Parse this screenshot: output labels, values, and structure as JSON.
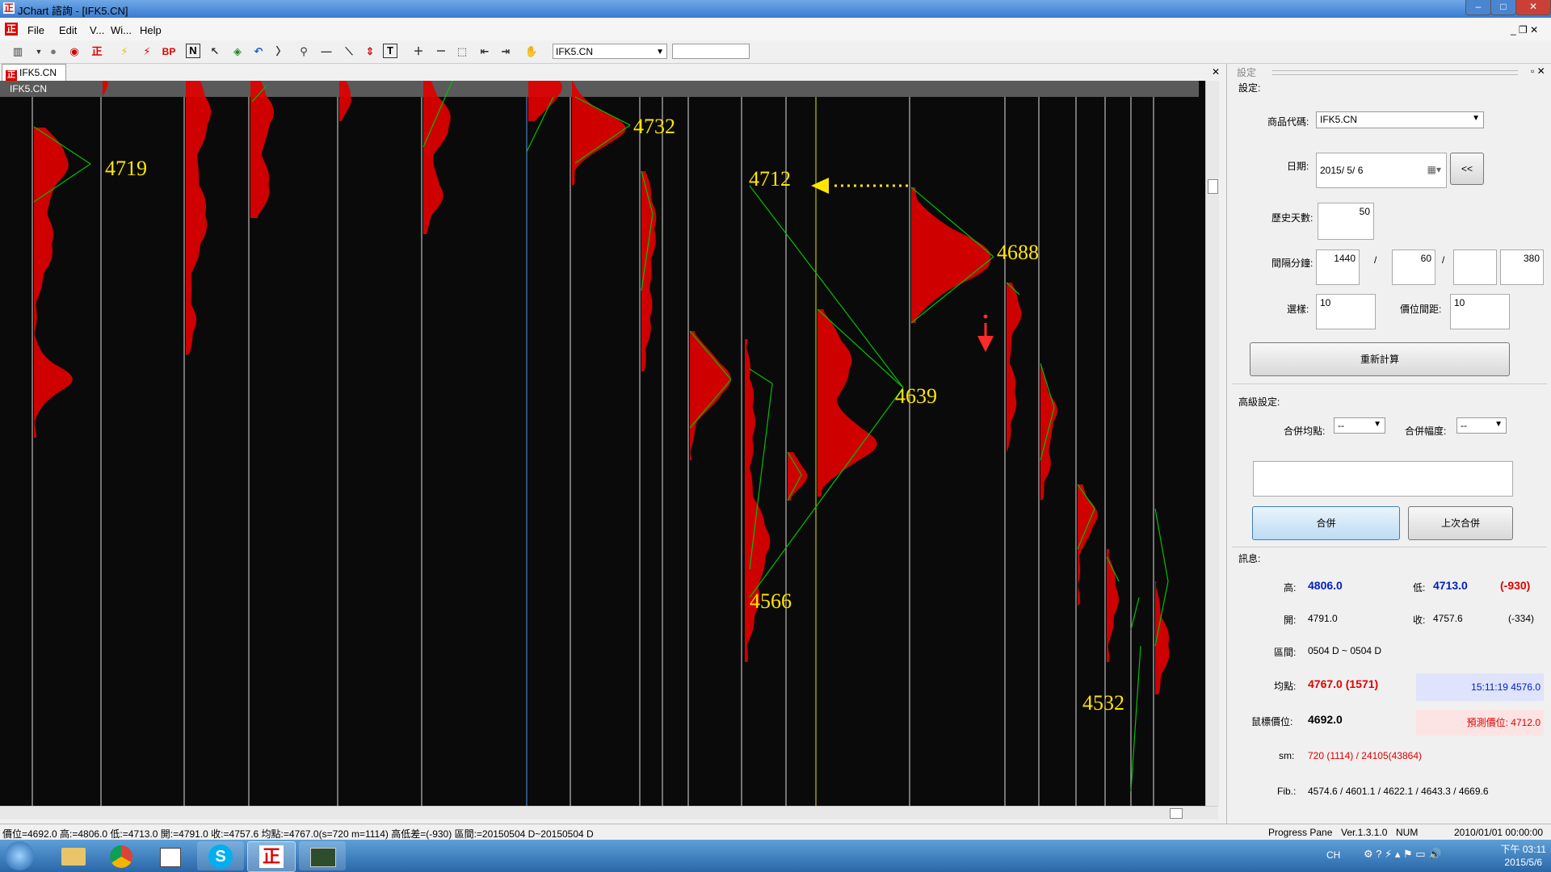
{
  "window": {
    "title": "JChart 諮詢 - [IFK5.CN]"
  },
  "menu": {
    "file": "File",
    "edit": "Edit",
    "view": "V...",
    "window": "Wi...",
    "help": "Help"
  },
  "toolbar": {
    "bp_label": "BP",
    "n_label": "N",
    "t_label": "T",
    "symbol": "IFK5.CN"
  },
  "chart_tab": {
    "label": "IFK5.CN"
  },
  "chart": {
    "header": "IFK5.CN",
    "labels": [
      "4719",
      "4732",
      "4712",
      "4688",
      "4639",
      "4566",
      "4532"
    ]
  },
  "panel": {
    "settings_title": "設定",
    "settings_section": "設定:",
    "symbol_label": "商品代碼:",
    "symbol_value": "IFK5.CN",
    "date_label": "日期:",
    "date_value": "2015/ 5/ 6",
    "back_button": "<<",
    "history_label": "歷史天數:",
    "history_value": "50",
    "interval_label": "間隔分鐘:",
    "interval_1": "1440",
    "interval_sep1": "/",
    "interval_2": "60",
    "interval_sep2": "/",
    "interval_3": "",
    "interval_4": "380",
    "select_label": "選樣:",
    "select_value": "10",
    "spacing_label": "價位間距:",
    "spacing_value": "10",
    "recalc_button": "重新計算",
    "advanced_label": "高級設定:",
    "merge_avg_label": "合併均點:",
    "merge_avg_value": "--",
    "merge_range_label": "合併幅度:",
    "merge_range_value": "--",
    "merge_button": "合併",
    "last_merge_button": "上次合併",
    "info_label": "訊息:",
    "high_label": "高:",
    "high_value": "4806.0",
    "low_label": "低:",
    "low_value": "4713.0",
    "low_diff": "(-930)",
    "open_label": "開:",
    "open_value": "4791.0",
    "close_label": "收:",
    "close_value": "4757.6",
    "close_diff": "(-334)",
    "range_label": "區間:",
    "range_value": "0504 D ~ 0504 D",
    "avg_label": "均點:",
    "avg_value": "4767.0 (1571)",
    "time_value": "15:11:19  4576.0",
    "mouse_label": "鼠標價位:",
    "mouse_value": "4692.0",
    "predict_value": "預測價位: 4712.0",
    "sm_label": "sm:",
    "sm_value": "720 (1114) / 24105(43864)",
    "fib_label": "Fib.:",
    "fib_value": "4574.6 / 4601.1 / 4622.1 / 4643.3 / 4669.6"
  },
  "status": {
    "left": "價位=4692.0 高:=4806.0 低:=4713.0 開:=4791.0 收:=4757.6 均點:=4767.0(s=720 m=1114) 高低差=(-930) 區間:=20150504 D~20150504 D",
    "progress": "Progress Pane",
    "version": "Ver.1.3.1.0",
    "num": "NUM",
    "datetime": "2010/01/01 00:00:00"
  },
  "taskbar": {
    "ime": "CH",
    "time": "下午 03:11",
    "date": "2015/5/6"
  },
  "colors": {
    "profile": "#e00000",
    "guide": "#00c000",
    "label": "#ffe600",
    "arrow": "#ffe600"
  }
}
